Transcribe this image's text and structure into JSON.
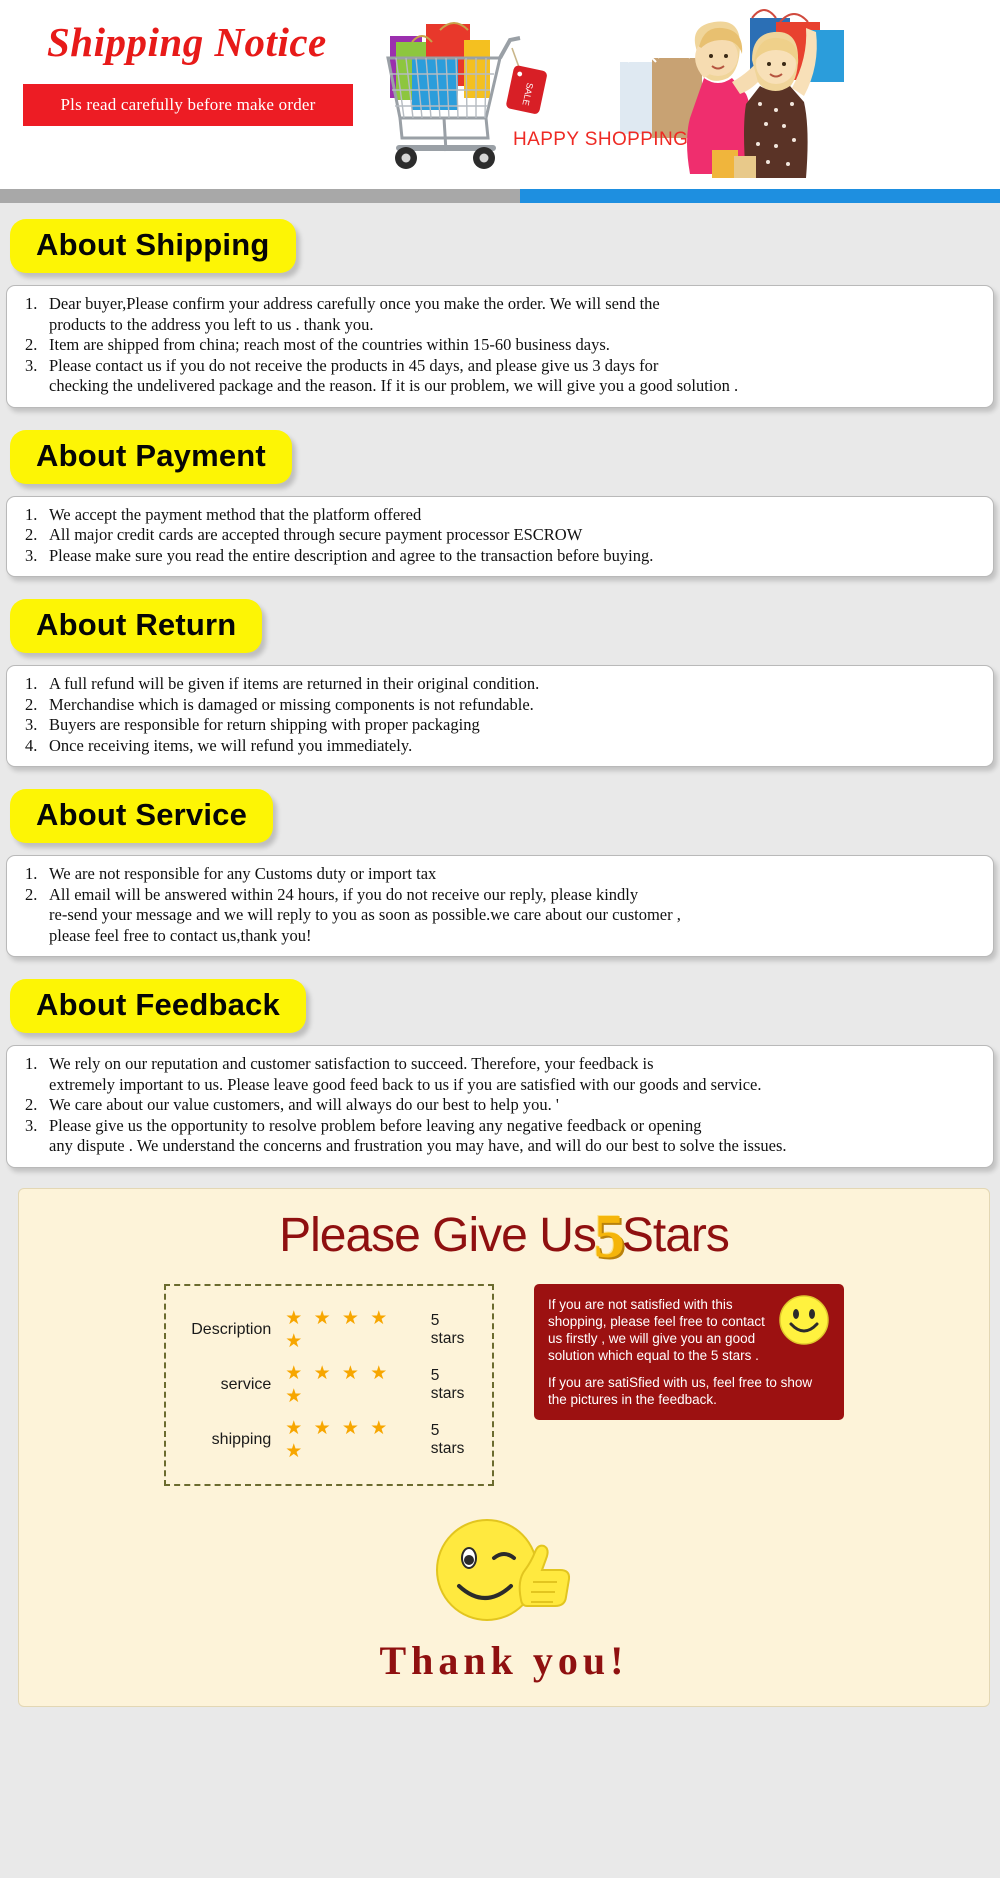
{
  "header": {
    "title": "Shipping Notice",
    "ribbon": "Pls read carefully before make order",
    "happy_shopping": "HAPPY SHOPPING",
    "sale_tag": "SALE",
    "accent_red": "#ed1c24",
    "accent_blue": "#1e8fe0"
  },
  "sections": [
    {
      "heading": "About Shipping",
      "items": [
        {
          "line1": "Dear buyer,Please confirm your address carefully once you make the order. We will send the",
          "line2": "products to the address you left to us . thank you."
        },
        {
          "line1": "Item are shipped from china; reach most of the countries within 15-60 business days.",
          "line2": ""
        },
        {
          "line1": "Please contact us if you do not receive the products in 45 days, and please give us 3 days for",
          "line2": "checking the undelivered package and the reason. If it is our problem, we will give you a good solution ."
        }
      ]
    },
    {
      "heading": "About Payment",
      "items": [
        {
          "line1": "We accept the payment method that the platform offered",
          "line2": ""
        },
        {
          "line1": "All major credit cards are accepted through secure payment processor ESCROW",
          "line2": ""
        },
        {
          "line1": "Please make sure you read the entire description and agree to the transaction before buying.",
          "line2": ""
        }
      ]
    },
    {
      "heading": "About Return",
      "items": [
        {
          "line1": "A full refund will be given if items are returned in their original condition.",
          "line2": ""
        },
        {
          "line1": "Merchandise which is damaged or missing components is not refundable.",
          "line2": ""
        },
        {
          "line1": "Buyers are responsible for return shipping with proper packaging",
          "line2": ""
        },
        {
          "line1": "Once receiving items, we will refund you immediately.",
          "line2": ""
        }
      ]
    },
    {
      "heading": "About Service",
      "items": [
        {
          "line1": "We are not responsible for any Customs duty or import tax",
          "line2": ""
        },
        {
          "line1": "All email will be answered within 24 hours, if you do not receive our reply, please kindly",
          "line2": "re-send your message and we will reply to you as soon as possible.we care about our customer ,",
          "line3": "please feel free to contact us,thank you!"
        }
      ]
    },
    {
      "heading": "About Feedback",
      "items": [
        {
          "line1": "We rely on our reputation and customer satisfaction to succeed. Therefore, your feedback is",
          "line2": "extremely important to us. Please leave good feed back to us if you are satisfied with our goods and service."
        },
        {
          "line1": "We care about our value customers, and will always do our best to help you. '",
          "line2": ""
        },
        {
          "line1": "Please give us the opportunity to resolve problem before leaving any negative feedback or opening",
          "line2": "any dispute . We understand the concerns and frustration you may have, and will do our best to solve the issues."
        }
      ]
    }
  ],
  "stars_panel": {
    "title_before": "Please Give Us",
    "title_number": "5",
    "title_after": "Stars",
    "ratings": [
      {
        "label": "Description",
        "stars": "★ ★ ★ ★ ★",
        "value": "5 stars"
      },
      {
        "label": "service",
        "stars": "★ ★ ★ ★ ★",
        "value": "5 stars"
      },
      {
        "label": "shipping",
        "stars": "★ ★ ★ ★ ★",
        "value": "5 stars"
      }
    ],
    "notice_1": "If you are not satisfied with this shopping, please feel free to contact us firstly , we will give you an good solution which equal to the 5 stars .",
    "notice_2": "If you are satiSfied with us, feel free to show the pictures in the feedback.",
    "thank_you": "Thank  you!"
  }
}
